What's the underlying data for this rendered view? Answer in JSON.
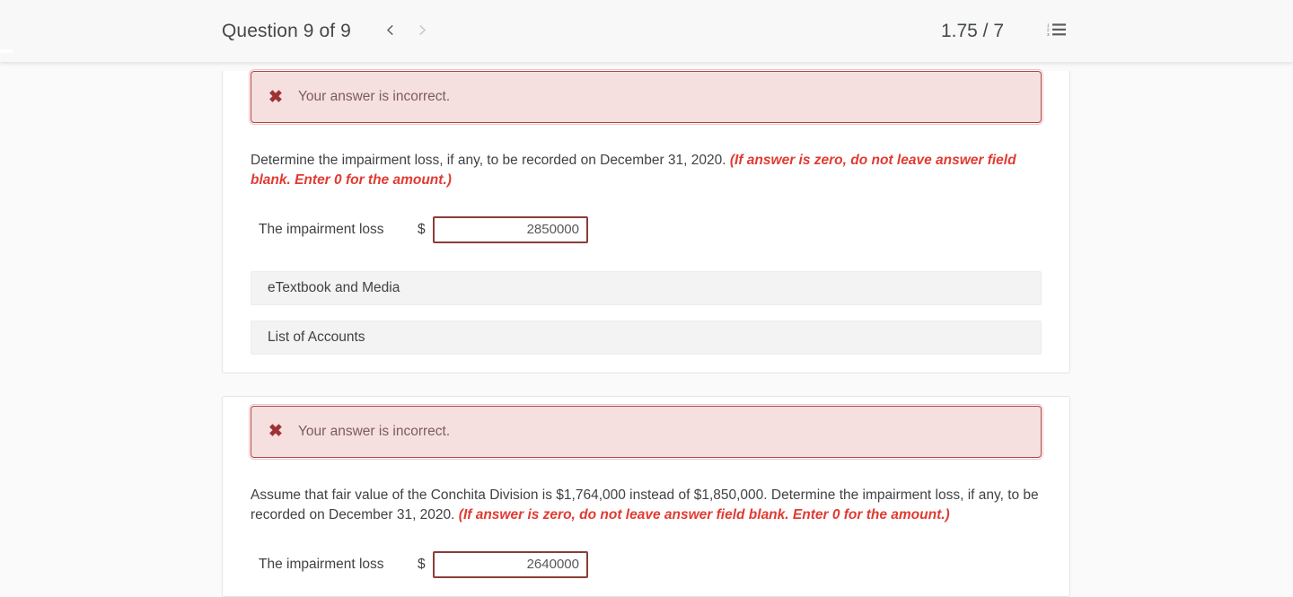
{
  "header": {
    "question_title": "Question 9 of 9",
    "prev_label": "Previous question",
    "next_label": "Next question",
    "prev_icon": "chevron-left-icon",
    "next_icon": "chevron-right-icon",
    "score": "1.75 / 7",
    "list_icon": "numbered-list-icon",
    "list_label": "Question list"
  },
  "colors": {
    "alert_bg": "#f6dfdf",
    "alert_border": "#a94442",
    "alert_icon": "#9d3234",
    "emphasis_red": "#e03b32",
    "input_border": "#8b3d38",
    "page_bg": "#fafafa",
    "card_bg": "#ffffff",
    "bar_bg": "#f3f3f3"
  },
  "parts": [
    {
      "alert": {
        "icon": "error-x-icon",
        "message": "Your answer is incorrect."
      },
      "question": {
        "text": "Determine the impairment loss, if any, to be recorded on December 31, 2020. ",
        "emphasis": "(If answer is zero, do not leave answer field blank. Enter 0 for the amount.)"
      },
      "answer": {
        "label": "The impairment loss",
        "currency": "$",
        "value": "2850000",
        "placeholder": ""
      },
      "bars": [
        {
          "label": "eTextbook and Media"
        },
        {
          "label": "List of Accounts"
        }
      ]
    },
    {
      "alert": {
        "icon": "error-x-icon",
        "message": "Your answer is incorrect."
      },
      "question": {
        "text": "Assume that fair value of the Conchita Division is $1,764,000 instead of $1,850,000. Determine the impairment loss, if any, to be recorded on December 31, 2020. ",
        "emphasis": "(If answer is zero, do not leave answer field blank. Enter 0 for the amount.)"
      },
      "answer": {
        "label": "The impairment loss",
        "currency": "$",
        "value": "2640000",
        "placeholder": ""
      },
      "bars": []
    }
  ]
}
